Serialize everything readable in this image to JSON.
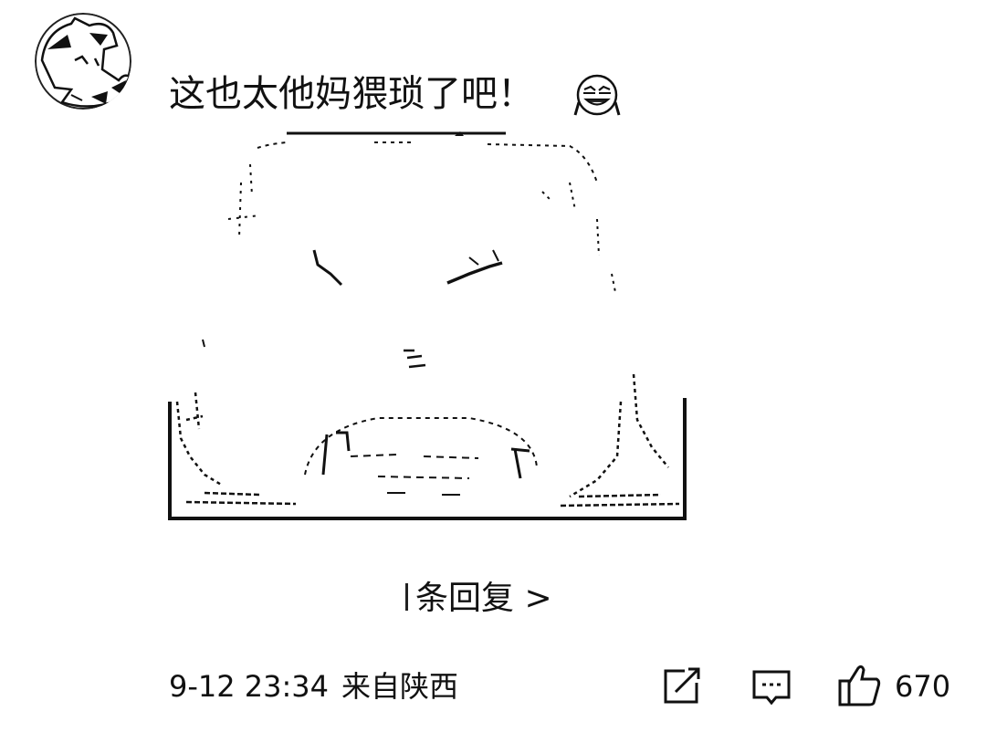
{
  "comment": {
    "text": "这也太他妈猥琐了吧！",
    "emoji_icon": "laughing-tears-emoji-icon"
  },
  "replies": {
    "label": "条回复 >"
  },
  "meta": {
    "timestamp": "9-12 23:34",
    "location": "来自陕西"
  },
  "actions": {
    "share_icon": "share-icon",
    "comment_icon": "comment-icon",
    "like_icon": "thumbs-up-icon",
    "like_count": "670"
  }
}
